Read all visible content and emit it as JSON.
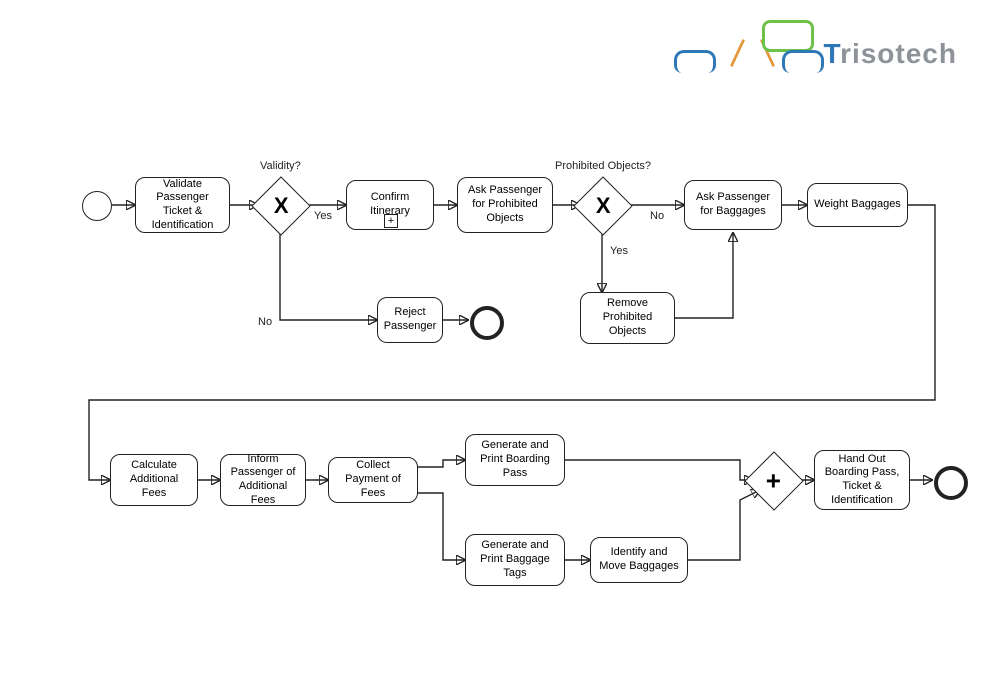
{
  "logo": {
    "brand1": "T",
    "brand2": "risotech"
  },
  "tasks": {
    "validate": "Validate Passenger Ticket & Identification",
    "confirm": "Confirm Itinerary",
    "askProhibited": "Ask Passenger for Prohibited Objects",
    "askBaggages": "Ask Passenger for Baggages",
    "weight": "Weight Baggages",
    "reject": "Reject Passenger",
    "remove": "Remove Prohibited Objects",
    "calc": "Calculate Additional Fees",
    "inform": "Inform Passenger of Additional Fees",
    "collect": "Collect Payment of Fees",
    "genBoarding": "Generate and Print Boarding Pass",
    "genTags": "Generate and Print Baggage Tags",
    "identifyMove": "Identify and Move Baggages",
    "handOut": "Hand Out Boarding Pass, Ticket & Identification"
  },
  "gateways": {
    "validityMark": "X",
    "prohibitedMark": "X",
    "parallelMark": "+"
  },
  "labels": {
    "validity": "Validity?",
    "validityYes": "Yes",
    "validityNo": "No",
    "prohibited": "Prohibited Objects?",
    "prohibitedYes": "Yes",
    "prohibitedNo": "No"
  },
  "markers": {
    "subprocess": "+"
  }
}
